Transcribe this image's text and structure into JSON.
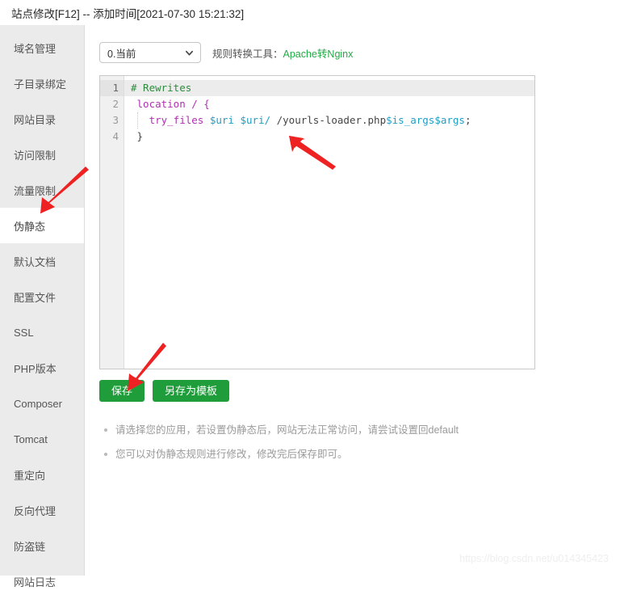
{
  "window": {
    "title": "站点修改[F12] -- 添加时间[2021-07-30 15:21:32]"
  },
  "sidebar": {
    "items": [
      {
        "label": "域名管理",
        "name": "domain-management",
        "active": false
      },
      {
        "label": "子目录绑定",
        "name": "subdirectory-binding",
        "active": false
      },
      {
        "label": "网站目录",
        "name": "website-directory",
        "active": false
      },
      {
        "label": "访问限制",
        "name": "access-restriction",
        "active": false
      },
      {
        "label": "流量限制",
        "name": "traffic-limit",
        "active": false
      },
      {
        "label": "伪静态",
        "name": "rewrite",
        "active": true
      },
      {
        "label": "默认文档",
        "name": "default-document",
        "active": false
      },
      {
        "label": "配置文件",
        "name": "config-file",
        "active": false
      },
      {
        "label": "SSL",
        "name": "ssl",
        "active": false
      },
      {
        "label": "PHP版本",
        "name": "php-version",
        "active": false
      },
      {
        "label": "Composer",
        "name": "composer",
        "active": false
      },
      {
        "label": "Tomcat",
        "name": "tomcat",
        "active": false
      },
      {
        "label": "重定向",
        "name": "redirect",
        "active": false
      },
      {
        "label": "反向代理",
        "name": "reverse-proxy",
        "active": false
      },
      {
        "label": "防盗链",
        "name": "hotlink-protection",
        "active": false
      },
      {
        "label": "网站日志",
        "name": "website-log",
        "active": false
      }
    ]
  },
  "toolbar": {
    "select_value": "0.当前",
    "select_options": [
      "0.当前"
    ],
    "converter_label": "规则转换工具：",
    "converter_link": "Apache转Nginx",
    "link_color": "#22aa44"
  },
  "editor": {
    "line_numbers": [
      "1",
      "2",
      "3",
      "4"
    ],
    "active_line": 1,
    "lines": [
      {
        "number": "1",
        "tokens": [
          {
            "text": "# Rewrites",
            "type": "comment"
          }
        ]
      },
      {
        "number": "2",
        "tokens": [
          {
            "text": " location / {",
            "type": "keyword"
          }
        ]
      },
      {
        "number": "3",
        "tokens": [
          {
            "text": "   try_files ",
            "type": "keyword"
          },
          {
            "text": "$uri $uri/",
            "type": "var"
          },
          {
            "text": " /yourls-loader.php",
            "type": "plain"
          },
          {
            "text": "$is_args$args",
            "type": "var"
          },
          {
            "text": ";",
            "type": "plain"
          }
        ]
      },
      {
        "number": "4",
        "tokens": [
          {
            "text": " }",
            "type": "plain"
          }
        ]
      }
    ],
    "plain_text": "# Rewrites\n location / {\n   try_files $uri $uri/ /yourls-loader.php$is_args$args;\n }"
  },
  "buttons": {
    "save": "保存",
    "save_as_template": "另存为模板",
    "color": "#1f9d3a"
  },
  "hints": [
    "请选择您的应用，若设置伪静态后，网站无法正常访问，请尝试设置回default",
    "您可以对伪静态规则进行修改，修改完后保存即可。"
  ],
  "annotations": {
    "arrow_color": "#ee2222",
    "arrows": [
      {
        "name": "arrow-pointing-to-rewrite-sidebar-item"
      },
      {
        "name": "arrow-pointing-to-code-line"
      },
      {
        "name": "arrow-pointing-to-save-button"
      }
    ]
  },
  "watermark": {
    "text": "https://blog.csdn.net/u014345423"
  }
}
